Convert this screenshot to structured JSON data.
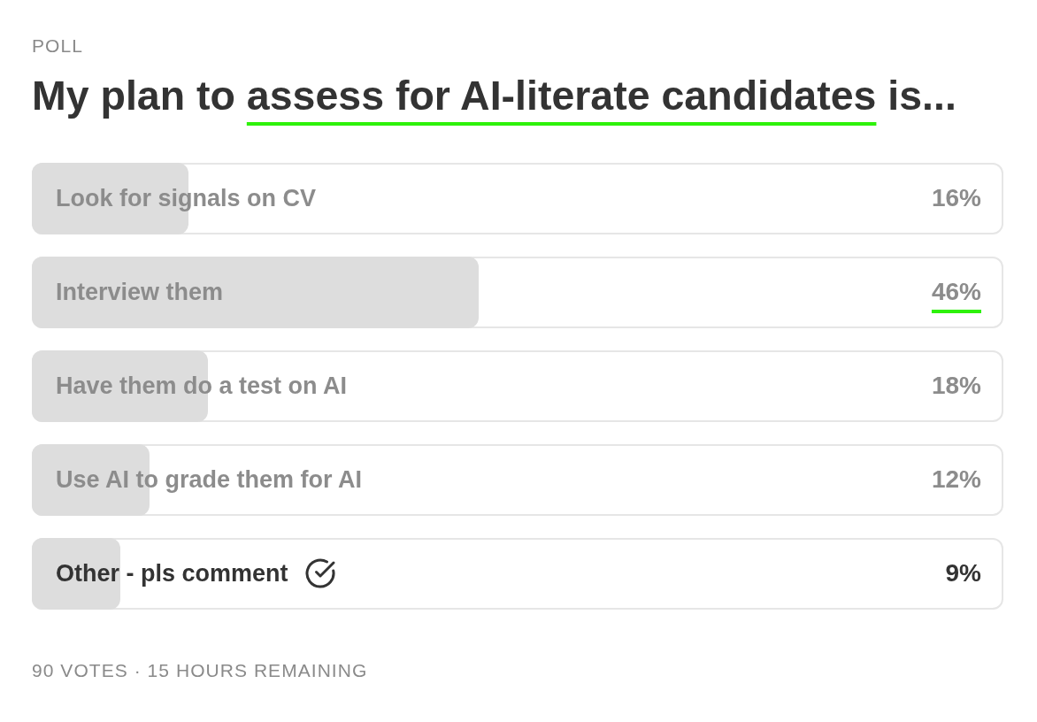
{
  "poll_label": "POLL",
  "question": {
    "lead": "My plan to ",
    "underlined": "assess for AI-literate candidates",
    "tail": " is..."
  },
  "options": [
    {
      "label": "Look for signals on CV",
      "percent": "16%",
      "level": 0.16,
      "selected": false,
      "percent_underlined": false
    },
    {
      "label": "Interview them",
      "percent": "46%",
      "level": 0.46,
      "selected": false,
      "percent_underlined": true
    },
    {
      "label": "Have them do a test on AI",
      "percent": "18%",
      "level": 0.18,
      "selected": false,
      "percent_underlined": false
    },
    {
      "label": "Use AI to grade them for AI",
      "percent": "12%",
      "level": 0.12,
      "selected": false,
      "percent_underlined": false
    },
    {
      "label": "Other - pls comment",
      "percent": "9%",
      "level": 0.09,
      "selected": true,
      "percent_underlined": false
    }
  ],
  "footer": "90 VOTES · 15 HOURS REMAINING"
}
